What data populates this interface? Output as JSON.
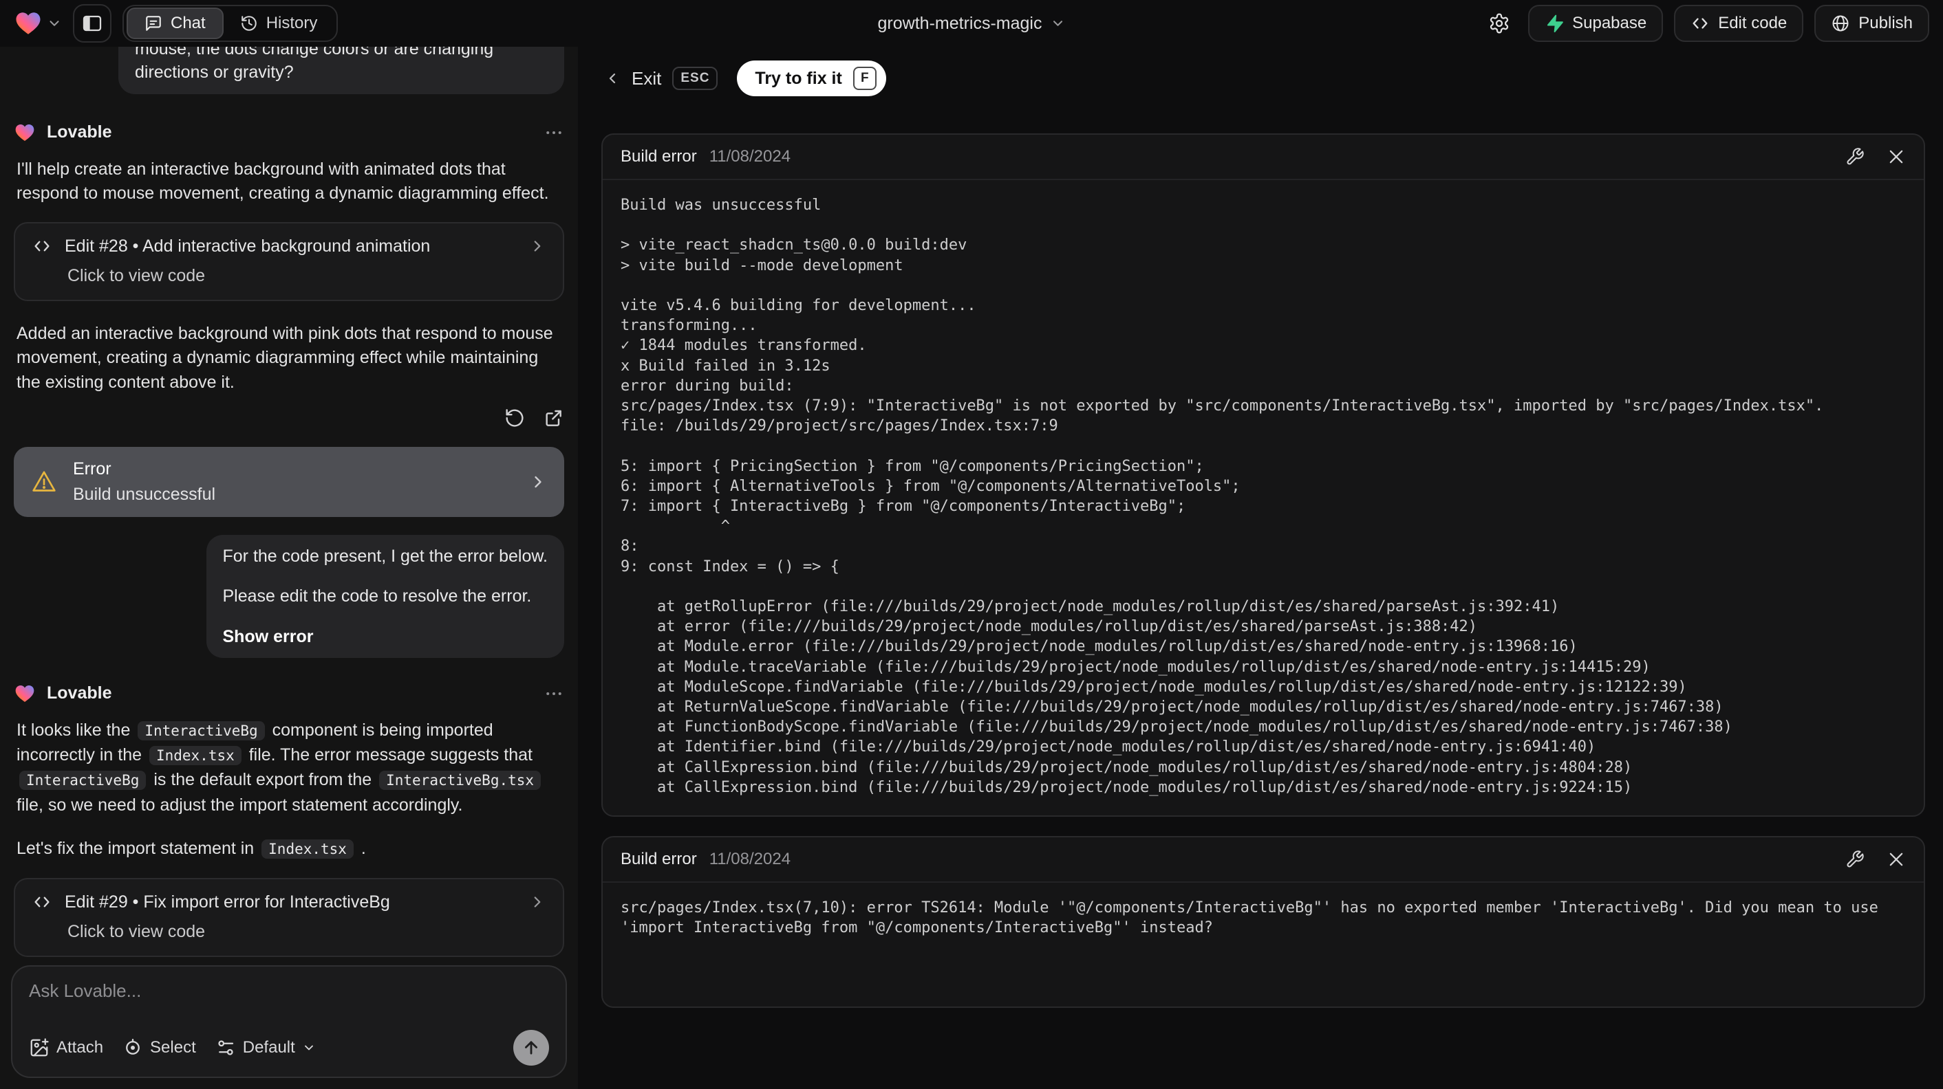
{
  "colors": {
    "supabase_green": "#3ecf8e",
    "warning_yellow": "#e7b63f",
    "error_card_bg": "#4e4f54",
    "accent_button_bg": "#ffffff"
  },
  "topbar": {
    "chat_tab": "Chat",
    "history_tab": "History",
    "project_name": "growth-metrics-magic",
    "supabase_label": "Supabase",
    "edit_code_label": "Edit code",
    "publish_label": "Publish"
  },
  "chat": {
    "assistant_name": "Lovable",
    "user_message_1": "maybe diagramming points and when you move the mouse, the dots change colors or are changing directions or gravity?",
    "assistant_1": {
      "intro": "I'll help create an interactive background with animated dots that respond to mouse movement, creating a dynamic diagramming effect.",
      "edit_card": {
        "title": "Edit #28 • Add interactive background animation",
        "subtitle": "Click to view code"
      },
      "summary": "Added an interactive background with pink dots that respond to mouse movement, creating a dynamic diagramming effect while maintaining the existing content above it."
    },
    "error_card": {
      "title": "Error",
      "subtitle": "Build unsuccessful"
    },
    "user_message_2": {
      "line1": "For the code present, I get the error below.",
      "line2": "Please edit the code to resolve the error.",
      "action": "Show error"
    },
    "assistant_2": {
      "p1": [
        {
          "text": "It looks like the "
        },
        {
          "code": "InteractiveBg"
        },
        {
          "text": " component is being imported incorrectly in the "
        },
        {
          "code": "Index.tsx"
        },
        {
          "text": " file. The error message suggests that "
        },
        {
          "code": "InteractiveBg"
        },
        {
          "text": " is the default export from the "
        },
        {
          "code": "InteractiveBg.tsx"
        },
        {
          "text": " file, so we need to adjust the import statement accordingly."
        }
      ],
      "p2": [
        {
          "text": "Let's fix the import statement in "
        },
        {
          "code": "Index.tsx"
        },
        {
          "text": " ."
        }
      ],
      "edit_card": {
        "title": "Edit #29 • Fix import error for InteractiveBg",
        "subtitle": "Click to view code"
      }
    },
    "composer": {
      "placeholder": "Ask Lovable...",
      "attach_label": "Attach",
      "select_label": "Select",
      "mode_label": "Default"
    }
  },
  "overlay": {
    "exit_label": "Exit",
    "esc_key": "ESC",
    "fix_label": "Try to fix it",
    "fix_key": "F",
    "panels": [
      {
        "title": "Build error",
        "date": "11/08/2024",
        "log_lines": [
          "Build was unsuccessful",
          "",
          "> vite_react_shadcn_ts@0.0.0 build:dev",
          "> vite build --mode development",
          "",
          "vite v5.4.6 building for development...",
          "transforming...",
          "✓ 1844 modules transformed.",
          "x Build failed in 3.12s",
          "error during build:",
          "src/pages/Index.tsx (7:9): \"InteractiveBg\" is not exported by \"src/components/InteractiveBg.tsx\", imported by \"src/pages/Index.tsx\".",
          "file: /builds/29/project/src/pages/Index.tsx:7:9",
          "",
          "5: import { PricingSection } from \"@/components/PricingSection\";",
          "6: import { AlternativeTools } from \"@/components/AlternativeTools\";",
          "7: import { InteractiveBg } from \"@/components/InteractiveBg\";",
          "           ^",
          "8:",
          "9: const Index = () => {",
          "",
          "    at getRollupError (file:///builds/29/project/node_modules/rollup/dist/es/shared/parseAst.js:392:41)",
          "    at error (file:///builds/29/project/node_modules/rollup/dist/es/shared/parseAst.js:388:42)",
          "    at Module.error (file:///builds/29/project/node_modules/rollup/dist/es/shared/node-entry.js:13968:16)",
          "    at Module.traceVariable (file:///builds/29/project/node_modules/rollup/dist/es/shared/node-entry.js:14415:29)",
          "    at ModuleScope.findVariable (file:///builds/29/project/node_modules/rollup/dist/es/shared/node-entry.js:12122:39)",
          "    at ReturnValueScope.findVariable (file:///builds/29/project/node_modules/rollup/dist/es/shared/node-entry.js:7467:38)",
          "    at FunctionBodyScope.findVariable (file:///builds/29/project/node_modules/rollup/dist/es/shared/node-entry.js:7467:38)",
          "    at Identifier.bind (file:///builds/29/project/node_modules/rollup/dist/es/shared/node-entry.js:6941:40)",
          "    at CallExpression.bind (file:///builds/29/project/node_modules/rollup/dist/es/shared/node-entry.js:4804:28)",
          "    at CallExpression.bind (file:///builds/29/project/node_modules/rollup/dist/es/shared/node-entry.js:9224:15)"
        ]
      },
      {
        "title": "Build error",
        "date": "11/08/2024",
        "body": "src/pages/Index.tsx(7,10): error TS2614: Module '\"@/components/InteractiveBg\"' has no exported member 'InteractiveBg'. Did you mean to use 'import InteractiveBg from \"@/components/InteractiveBg\"' instead?"
      }
    ]
  }
}
